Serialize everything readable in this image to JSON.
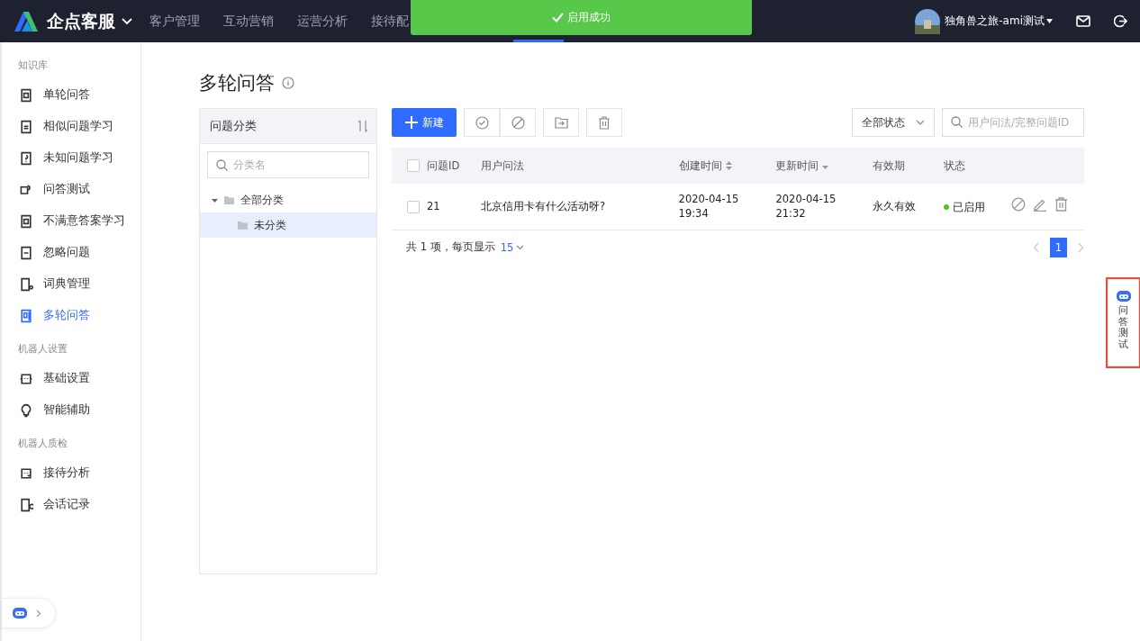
{
  "topbar": {
    "brand": "企点客服",
    "nav": [
      {
        "label": "客户管理",
        "selected": false
      },
      {
        "label": "互动营销",
        "selected": false
      },
      {
        "label": "运营分析",
        "selected": false
      },
      {
        "label": "接待配",
        "selected": false
      }
    ],
    "hidden_tab_active": true,
    "user": "独角兽之旅-ami测试"
  },
  "toast": {
    "text": "启用成功"
  },
  "sidebar": {
    "groups": [
      {
        "title": "知识库",
        "items": [
          {
            "label": "单轮问答",
            "selected": false
          },
          {
            "label": "相似问题学习",
            "selected": false
          },
          {
            "label": "未知问题学习",
            "selected": false
          },
          {
            "label": "问答测试",
            "selected": false
          },
          {
            "label": "不满意答案学习",
            "selected": false
          },
          {
            "label": "忽略问题",
            "selected": false
          },
          {
            "label": "词典管理",
            "selected": false
          },
          {
            "label": "多轮问答",
            "selected": true
          }
        ]
      },
      {
        "title": "机器人设置",
        "items": [
          {
            "label": "基础设置",
            "selected": false
          },
          {
            "label": "智能辅助",
            "selected": false
          }
        ]
      },
      {
        "title": "机器人质检",
        "items": [
          {
            "label": "接待分析",
            "selected": false
          },
          {
            "label": "会话记录",
            "selected": false
          }
        ]
      }
    ]
  },
  "page_title": "多轮问答",
  "category_panel": {
    "title": "问题分类",
    "search": {
      "placeholder": "分类名"
    },
    "tree": [
      {
        "label": "全部分类",
        "expanded": true,
        "selected": false,
        "children": [
          {
            "label": "未分类",
            "selected": true
          }
        ]
      }
    ]
  },
  "toolbar": {
    "new_button": "新建",
    "status_filter": "全部状态",
    "search": {
      "placeholder": "用户问法/完整问题ID"
    }
  },
  "table": {
    "all_checked": false,
    "columns": [
      {
        "label": "问题ID"
      },
      {
        "label": "用户问法"
      },
      {
        "label": "创建时间",
        "sorted": false
      },
      {
        "label": "更新时间",
        "sorted": true
      },
      {
        "label": "有效期"
      },
      {
        "label": "状态"
      }
    ],
    "rows": [
      {
        "checked": false,
        "id": "21",
        "question": "北京信用卡有什么活动呀?",
        "created": [
          "2020-04-15",
          "19:34"
        ],
        "updated": [
          "2020-04-15",
          "21:32"
        ],
        "validity": "永久有效",
        "status": "已启用",
        "enabled": true
      }
    ]
  },
  "pagination": {
    "summary": "共 1 项，每页显示",
    "page_size": "15",
    "pages": [
      {
        "label": "1",
        "selected": true
      }
    ]
  },
  "assistant_toggle": {
    "expanded": false
  },
  "float_button": {
    "label": "问答测试",
    "highlighted": true
  }
}
